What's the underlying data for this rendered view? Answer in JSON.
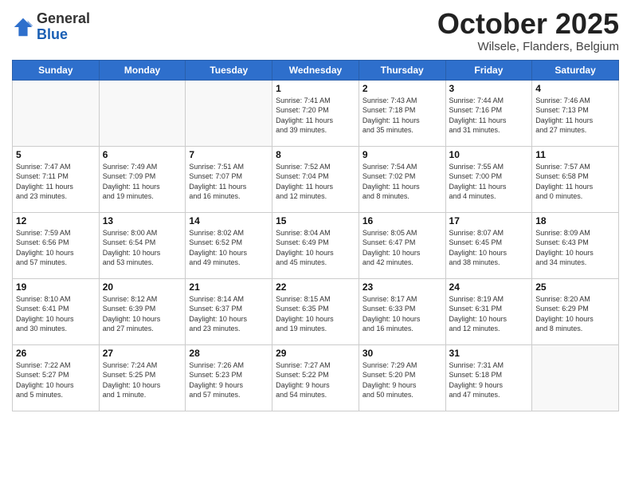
{
  "logo": {
    "general": "General",
    "blue": "Blue"
  },
  "header": {
    "month": "October 2025",
    "location": "Wilsele, Flanders, Belgium"
  },
  "days_of_week": [
    "Sunday",
    "Monday",
    "Tuesday",
    "Wednesday",
    "Thursday",
    "Friday",
    "Saturday"
  ],
  "weeks": [
    [
      {
        "day": "",
        "info": ""
      },
      {
        "day": "",
        "info": ""
      },
      {
        "day": "",
        "info": ""
      },
      {
        "day": "1",
        "info": "Sunrise: 7:41 AM\nSunset: 7:20 PM\nDaylight: 11 hours\nand 39 minutes."
      },
      {
        "day": "2",
        "info": "Sunrise: 7:43 AM\nSunset: 7:18 PM\nDaylight: 11 hours\nand 35 minutes."
      },
      {
        "day": "3",
        "info": "Sunrise: 7:44 AM\nSunset: 7:16 PM\nDaylight: 11 hours\nand 31 minutes."
      },
      {
        "day": "4",
        "info": "Sunrise: 7:46 AM\nSunset: 7:13 PM\nDaylight: 11 hours\nand 27 minutes."
      }
    ],
    [
      {
        "day": "5",
        "info": "Sunrise: 7:47 AM\nSunset: 7:11 PM\nDaylight: 11 hours\nand 23 minutes."
      },
      {
        "day": "6",
        "info": "Sunrise: 7:49 AM\nSunset: 7:09 PM\nDaylight: 11 hours\nand 19 minutes."
      },
      {
        "day": "7",
        "info": "Sunrise: 7:51 AM\nSunset: 7:07 PM\nDaylight: 11 hours\nand 16 minutes."
      },
      {
        "day": "8",
        "info": "Sunrise: 7:52 AM\nSunset: 7:04 PM\nDaylight: 11 hours\nand 12 minutes."
      },
      {
        "day": "9",
        "info": "Sunrise: 7:54 AM\nSunset: 7:02 PM\nDaylight: 11 hours\nand 8 minutes."
      },
      {
        "day": "10",
        "info": "Sunrise: 7:55 AM\nSunset: 7:00 PM\nDaylight: 11 hours\nand 4 minutes."
      },
      {
        "day": "11",
        "info": "Sunrise: 7:57 AM\nSunset: 6:58 PM\nDaylight: 11 hours\nand 0 minutes."
      }
    ],
    [
      {
        "day": "12",
        "info": "Sunrise: 7:59 AM\nSunset: 6:56 PM\nDaylight: 10 hours\nand 57 minutes."
      },
      {
        "day": "13",
        "info": "Sunrise: 8:00 AM\nSunset: 6:54 PM\nDaylight: 10 hours\nand 53 minutes."
      },
      {
        "day": "14",
        "info": "Sunrise: 8:02 AM\nSunset: 6:52 PM\nDaylight: 10 hours\nand 49 minutes."
      },
      {
        "day": "15",
        "info": "Sunrise: 8:04 AM\nSunset: 6:49 PM\nDaylight: 10 hours\nand 45 minutes."
      },
      {
        "day": "16",
        "info": "Sunrise: 8:05 AM\nSunset: 6:47 PM\nDaylight: 10 hours\nand 42 minutes."
      },
      {
        "day": "17",
        "info": "Sunrise: 8:07 AM\nSunset: 6:45 PM\nDaylight: 10 hours\nand 38 minutes."
      },
      {
        "day": "18",
        "info": "Sunrise: 8:09 AM\nSunset: 6:43 PM\nDaylight: 10 hours\nand 34 minutes."
      }
    ],
    [
      {
        "day": "19",
        "info": "Sunrise: 8:10 AM\nSunset: 6:41 PM\nDaylight: 10 hours\nand 30 minutes."
      },
      {
        "day": "20",
        "info": "Sunrise: 8:12 AM\nSunset: 6:39 PM\nDaylight: 10 hours\nand 27 minutes."
      },
      {
        "day": "21",
        "info": "Sunrise: 8:14 AM\nSunset: 6:37 PM\nDaylight: 10 hours\nand 23 minutes."
      },
      {
        "day": "22",
        "info": "Sunrise: 8:15 AM\nSunset: 6:35 PM\nDaylight: 10 hours\nand 19 minutes."
      },
      {
        "day": "23",
        "info": "Sunrise: 8:17 AM\nSunset: 6:33 PM\nDaylight: 10 hours\nand 16 minutes."
      },
      {
        "day": "24",
        "info": "Sunrise: 8:19 AM\nSunset: 6:31 PM\nDaylight: 10 hours\nand 12 minutes."
      },
      {
        "day": "25",
        "info": "Sunrise: 8:20 AM\nSunset: 6:29 PM\nDaylight: 10 hours\nand 8 minutes."
      }
    ],
    [
      {
        "day": "26",
        "info": "Sunrise: 7:22 AM\nSunset: 5:27 PM\nDaylight: 10 hours\nand 5 minutes."
      },
      {
        "day": "27",
        "info": "Sunrise: 7:24 AM\nSunset: 5:25 PM\nDaylight: 10 hours\nand 1 minute."
      },
      {
        "day": "28",
        "info": "Sunrise: 7:26 AM\nSunset: 5:23 PM\nDaylight: 9 hours\nand 57 minutes."
      },
      {
        "day": "29",
        "info": "Sunrise: 7:27 AM\nSunset: 5:22 PM\nDaylight: 9 hours\nand 54 minutes."
      },
      {
        "day": "30",
        "info": "Sunrise: 7:29 AM\nSunset: 5:20 PM\nDaylight: 9 hours\nand 50 minutes."
      },
      {
        "day": "31",
        "info": "Sunrise: 7:31 AM\nSunset: 5:18 PM\nDaylight: 9 hours\nand 47 minutes."
      },
      {
        "day": "",
        "info": ""
      }
    ]
  ]
}
